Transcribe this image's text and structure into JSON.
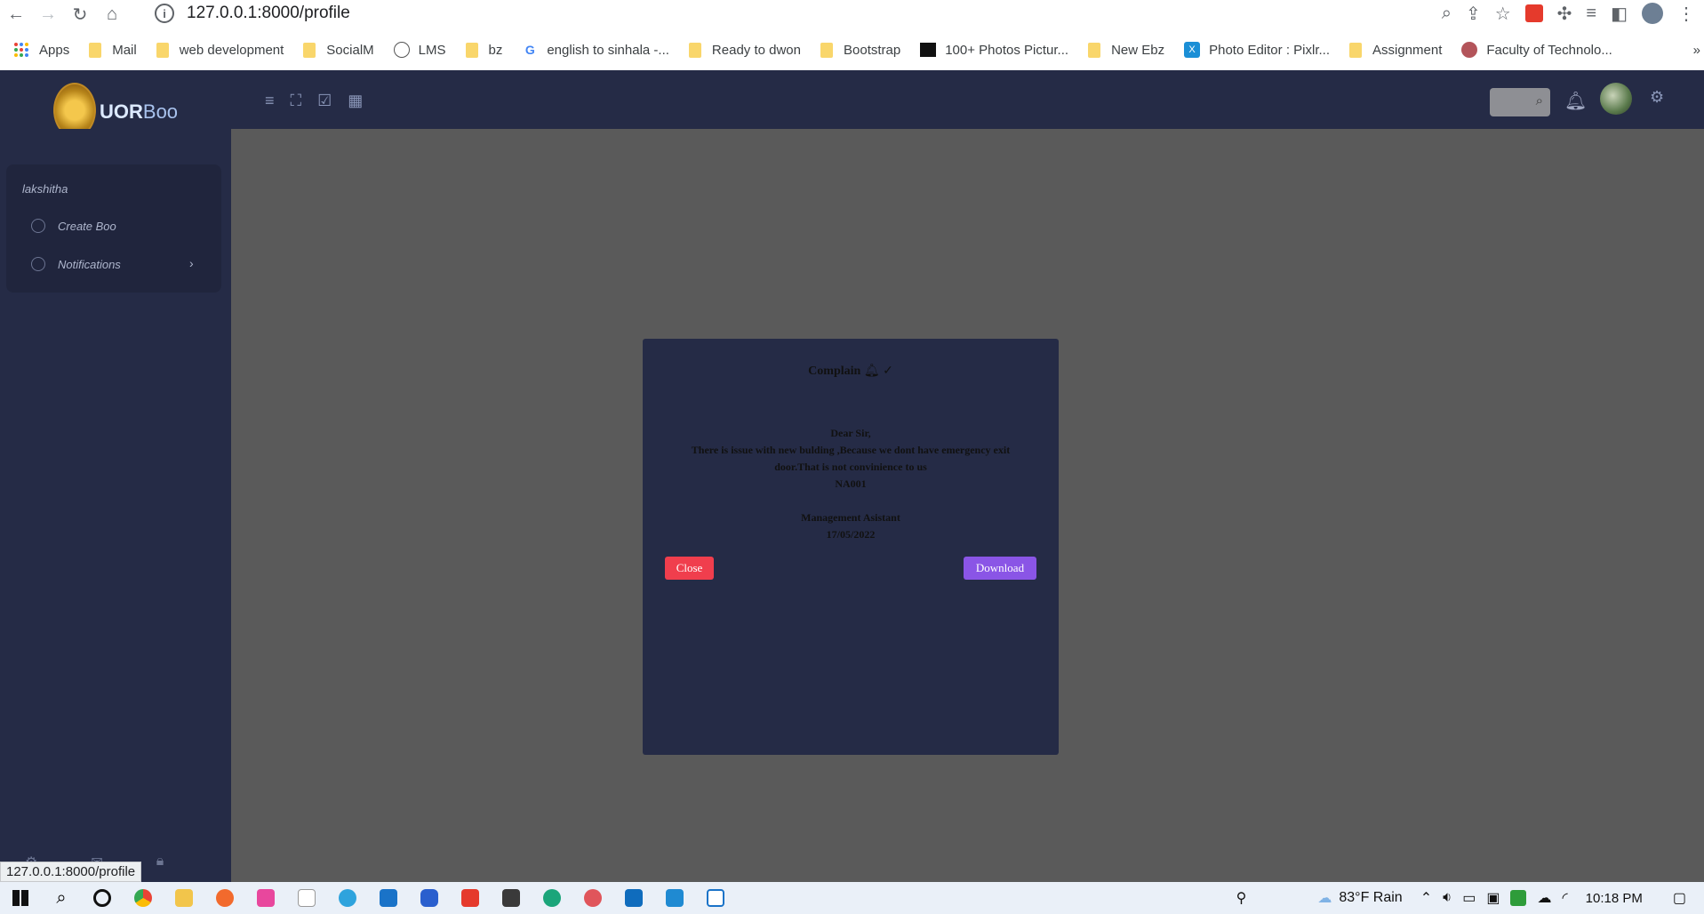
{
  "browser": {
    "url": "127.0.0.1:8000/profile",
    "status_url": "127.0.0.1:8000/profile",
    "bookmarks": [
      "Apps",
      "Mail",
      "web development",
      "SocialM",
      "LMS",
      "bz",
      "english to sinhala -...",
      "Ready to dwon",
      "Bootstrap",
      "100+ Photos Pictur...",
      "New Ebz",
      "Photo Editor : Pixlr...",
      "Assignment",
      "Faculty of Technolo..."
    ],
    "overflow": "»"
  },
  "header": {
    "brand_bold": "UOR",
    "brand_rest": "Boo"
  },
  "sidebar": {
    "user": "lakshitha",
    "items": [
      {
        "label": "Create Boo"
      },
      {
        "label": "Notifications"
      }
    ]
  },
  "modal": {
    "title": "Complain",
    "greeting": "Dear Sir,",
    "message": "There is issue with new bulding ,Because we dont have emergency exit door.That is not convinience to us",
    "code": "NA001",
    "role": "Management Asistant",
    "date": "17/05/2022",
    "close_label": "Close",
    "download_label": "Download"
  },
  "taskbar": {
    "weather": "83°F  Rain",
    "time": "10:18 PM"
  },
  "colors": {
    "accent": "#252b46",
    "close": "#f03e4d",
    "download": "#8a55e6"
  }
}
